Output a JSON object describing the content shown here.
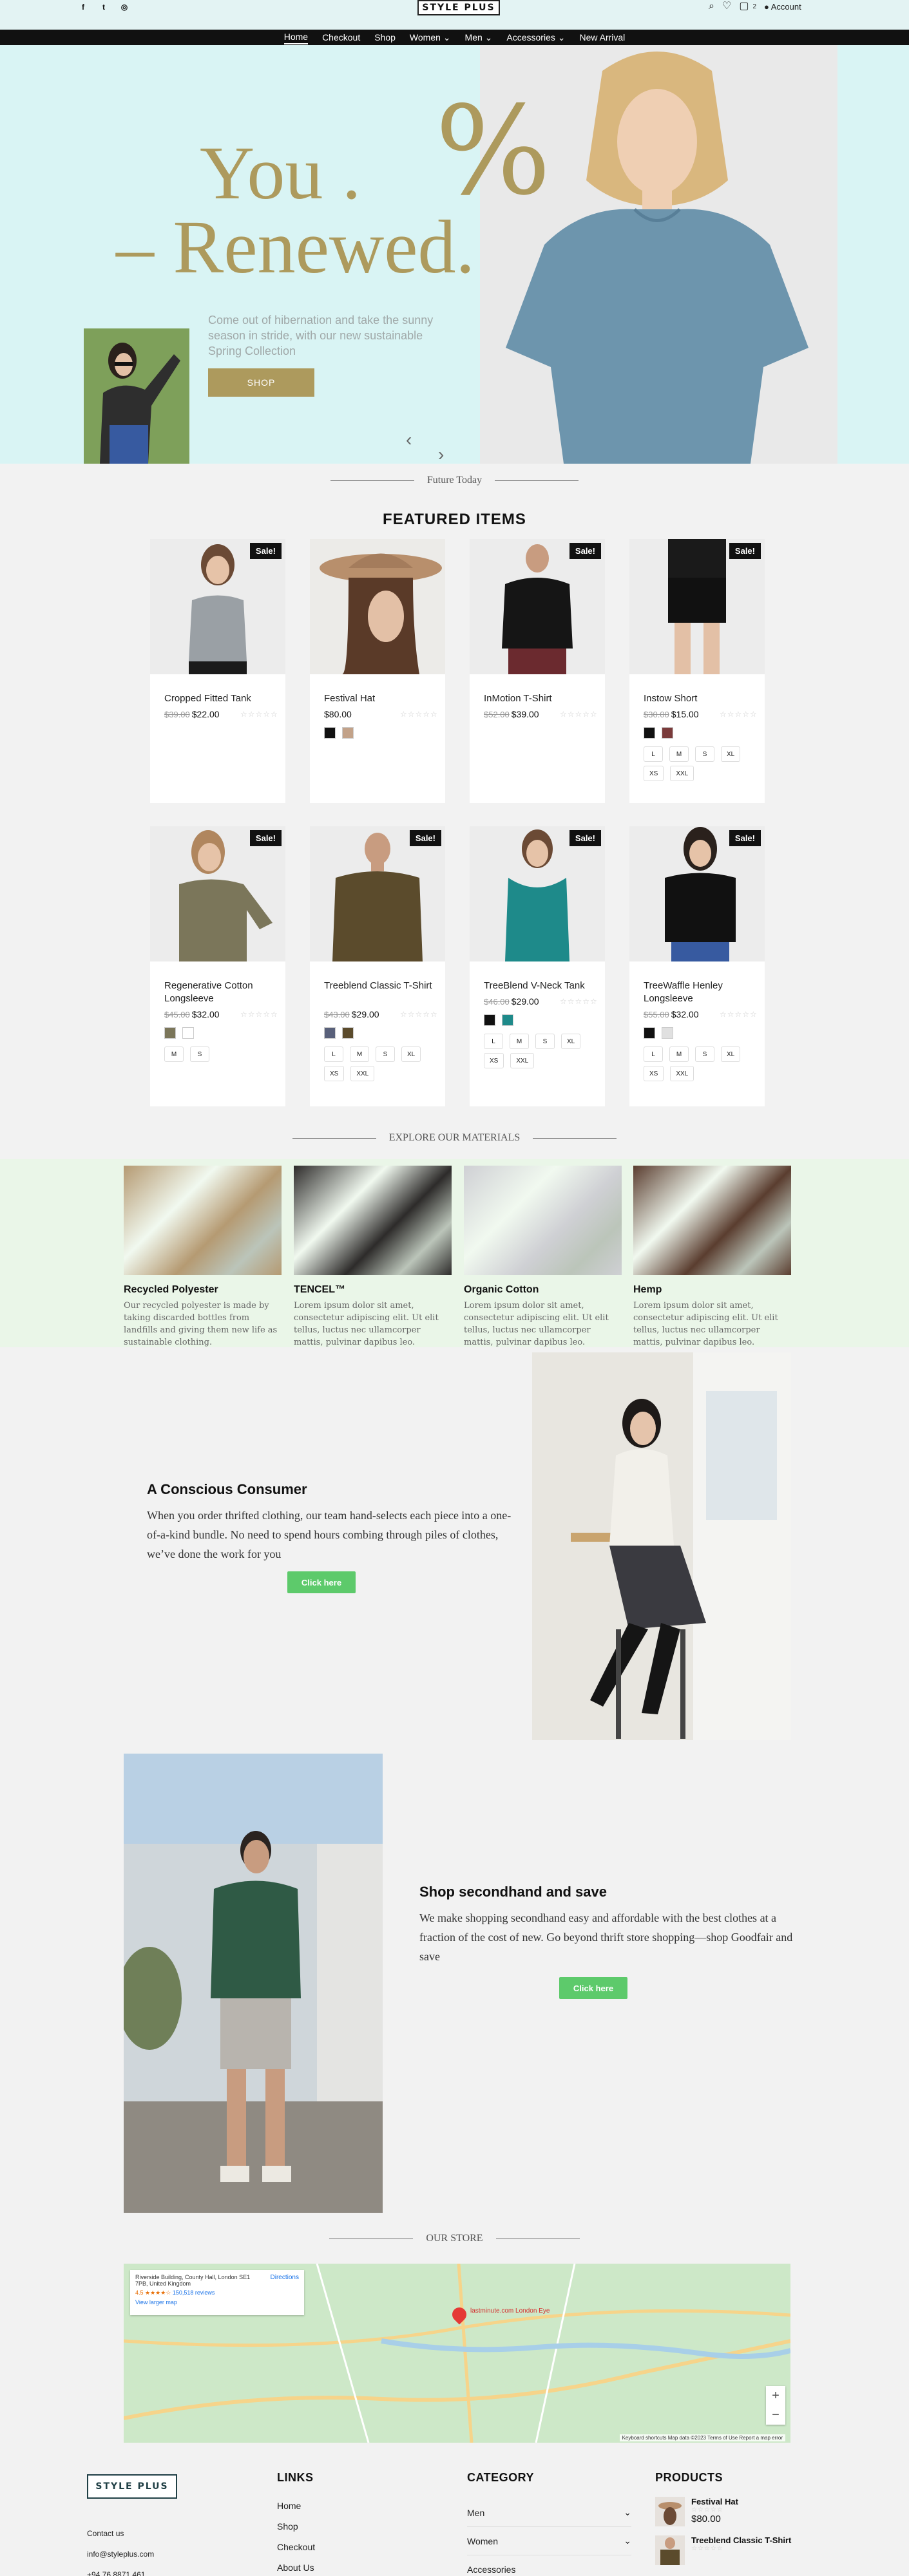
{
  "header": {
    "social_icons": [
      "facebook-icon",
      "twitter-icon",
      "instagram-icon"
    ],
    "logo": "STYLE PLUS",
    "cart_count": "2",
    "account_label": "Account"
  },
  "nav": [
    {
      "label": "Home",
      "active": true
    },
    {
      "label": "Checkout"
    },
    {
      "label": "Shop"
    },
    {
      "label": "Women ⌄"
    },
    {
      "label": "Men ⌄"
    },
    {
      "label": "Accessories ⌄"
    },
    {
      "label": "New Arrival"
    }
  ],
  "hero": {
    "percent": "%",
    "line1": "You .",
    "line2": "– Renewed.",
    "text": "Come out of hibernation and take the sunny season in stride, with our new sustainable Spring Collection",
    "button": "SHOP",
    "prev": "‹",
    "next": "›"
  },
  "sections": {
    "future_today": "Future Today",
    "featured": "FEATURED ITEMS",
    "materials": "EXPLORE OUR MATERIALS",
    "store": "OUR STORE"
  },
  "sale_label": "Sale!",
  "products": [
    {
      "name": "Cropped Fitted Tank",
      "old": "$39.00",
      "price": "$22.00",
      "sale": true,
      "swatches": [],
      "sizes": []
    },
    {
      "name": "Festival Hat",
      "old": "",
      "price": "$80.00",
      "sale": false,
      "swatches": [
        "#111111",
        "#c2a289"
      ],
      "sizes": []
    },
    {
      "name": "InMotion T-Shirt",
      "old": "$52.00",
      "price": "$39.00",
      "sale": true,
      "swatches": [],
      "sizes": []
    },
    {
      "name": "Instow Short",
      "old": "$30.00",
      "price": "$15.00",
      "sale": true,
      "swatches": [
        "#111111",
        "#7a3b3b"
      ],
      "sizes": [
        "L",
        "M",
        "S",
        "XL",
        "XS",
        "XXL"
      ]
    },
    {
      "name": "Regenerative Cotton Longsleeve",
      "old": "$45.00",
      "price": "$32.00",
      "sale": true,
      "swatches": [
        "#7b765a",
        "#ffffff"
      ],
      "sizes": [
        "M",
        "S"
      ]
    },
    {
      "name": "Treeblend Classic T-Shirt",
      "old": "$43.00",
      "price": "$29.00",
      "sale": true,
      "swatches": [
        "#59607a",
        "#5b4b2c"
      ],
      "sizes": [
        "L",
        "M",
        "S",
        "XL",
        "XS",
        "XXL"
      ]
    },
    {
      "name": "TreeBlend V-Neck Tank",
      "old": "$46.00",
      "price": "$29.00",
      "sale": true,
      "swatches": [
        "#111111",
        "#1e8a8a"
      ],
      "sizes": [
        "L",
        "M",
        "S",
        "XL",
        "XS",
        "XXL"
      ]
    },
    {
      "name": "TreeWaffle Henley Longsleeve",
      "old": "$55.00",
      "price": "$32.00",
      "sale": true,
      "swatches": [
        "#111111",
        "#e0e0e0"
      ],
      "sizes": [
        "L",
        "M",
        "S",
        "XL",
        "XS",
        "XXL"
      ]
    }
  ],
  "materials": [
    {
      "title": "Recycled Polyester",
      "text": "Our recycled polyester is made by taking discarded bottles from landfills and giving them new life as sustainable clothing.",
      "color": "#b59a72"
    },
    {
      "title": "TENCEL™",
      "text": "Lorem ipsum dolor sit amet, consectetur adipiscing elit. Ut elit tellus, luctus nec ullamcorper mattis, pulvinar dapibus leo.",
      "color": "#2d2b2a"
    },
    {
      "title": "Organic Cotton",
      "text": "Lorem ipsum dolor sit amet, consectetur adipiscing elit. Ut elit tellus, luctus nec ullamcorper mattis, pulvinar dapibus leo.",
      "color": "#cfd0d4"
    },
    {
      "title": "Hemp",
      "text": "Lorem ipsum dolor sit amet, consectetur adipiscing elit. Ut elit tellus, luctus nec ullamcorper mattis, pulvinar dapibus leo.",
      "color": "#5a3d2f"
    }
  ],
  "conscious": {
    "title": "A Conscious Consumer",
    "text": "When you order thrifted clothing, our team hand-selects each piece into a one-of-a-kind bundle. No need to spend hours combing through piles of clothes, we’ve done the work for you",
    "button": "Click here"
  },
  "secondhand": {
    "title": "Shop secondhand and save",
    "text": "We make shopping secondhand easy and affordable with the best clothes at a fraction of the cost of new. Go beyond thrift store shopping—shop Goodfair and save",
    "button": "Click here"
  },
  "map": {
    "address": "Riverside Building, County Hall, London SE1 7PB, United Kingdom",
    "directions": "Directions",
    "rating": "4.5 ★★★★☆",
    "reviews": "150,518 reviews",
    "larger": "View larger map",
    "pin_label": "lastminute.com London Eye",
    "footer": "Keyboard shortcuts   Map data ©2023   Terms of Use   Report a map error"
  },
  "footer": {
    "logo": "STYLE PLUS",
    "contact": [
      "Contact us",
      "info@styleplus.com",
      "+94 76 8871 461"
    ],
    "links_title": "LINKS",
    "links": [
      "Home",
      "Shop",
      "Checkout",
      "About Us"
    ],
    "category_title": "CATEGORY",
    "categories": [
      "Men",
      "Women",
      "Accessories"
    ],
    "products_title": "PRODUCTS",
    "products": [
      {
        "name": "Festival Hat",
        "price": "$80.00"
      },
      {
        "name": "Treeblend Classic T-Shirt",
        "price": ""
      }
    ]
  }
}
